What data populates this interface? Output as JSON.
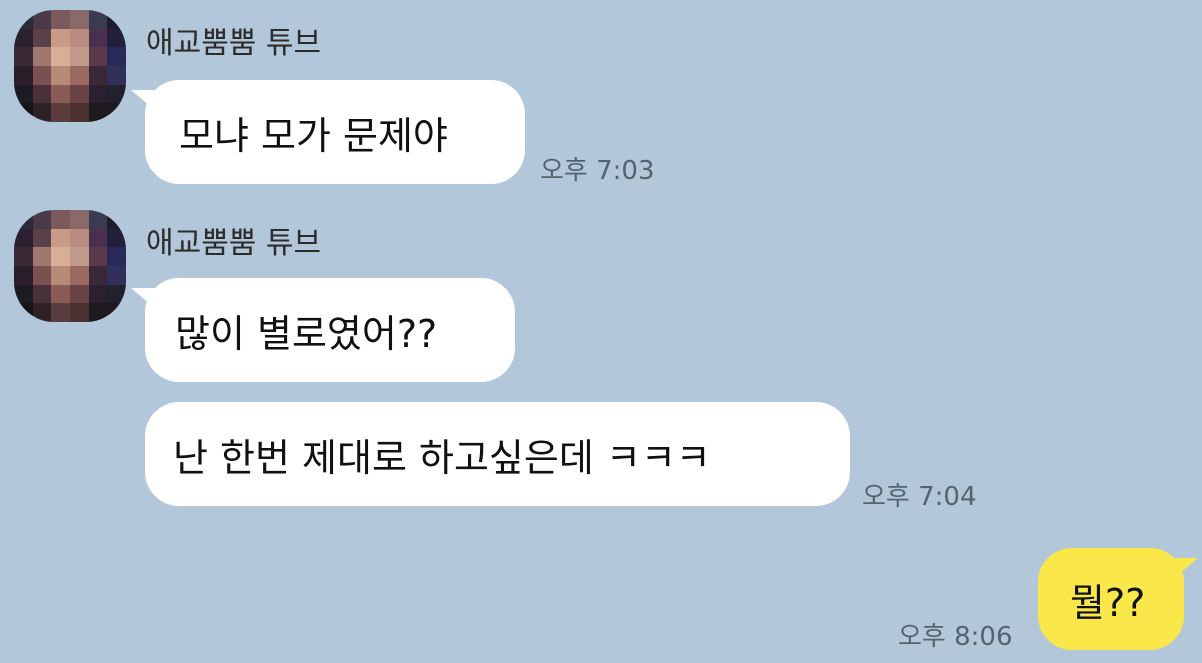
{
  "chat": {
    "messages": [
      {
        "sender": "애교뿜뿜 튜브",
        "text": "모냐 모가 문제야",
        "time": "오후 7:03"
      },
      {
        "sender": "애교뿜뿜 튜브",
        "text": "많이 별로였어??"
      },
      {
        "text": "난 한번 제대로 하고싶은데 ㅋㅋㅋ",
        "time": "오후 7:04"
      },
      {
        "text": "뭘??",
        "time": "오후 8:06"
      }
    ]
  },
  "colors": {
    "background": "#b2c7da",
    "incoming_bubble": "#ffffff",
    "outgoing_bubble": "#fae84a",
    "timestamp": "#55636f"
  },
  "icons": {
    "avatar": "pixelated-profile-photo"
  }
}
